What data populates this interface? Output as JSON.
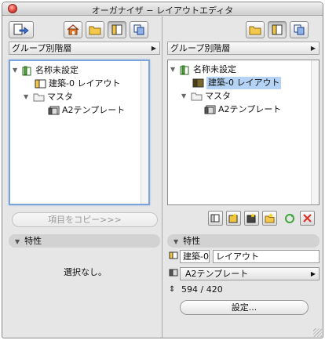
{
  "window": {
    "title": "オーガナイザ − レイアウトエディタ"
  },
  "left": {
    "toolbar": {
      "export_icon": "export-arrow-icon",
      "view_icons": [
        "house-icon",
        "folder-icon",
        "layout-sheet-icon",
        "copy-sheets-icon"
      ],
      "active_index": 2
    },
    "group_selector": "グループ別階層",
    "tree": [
      {
        "label": "名称未設定",
        "icon": "layout-book-icon",
        "expanded": true
      },
      {
        "label": "建築-0 レイアウト",
        "icon": "layout-icon"
      },
      {
        "label": "マスタ",
        "icon": "folder-icon",
        "expanded": true
      },
      {
        "label": "A2テンプレート",
        "icon": "master-layout-icon"
      }
    ],
    "copy_button": "項目をコピー>>>",
    "properties": {
      "header": "特性",
      "empty_text": "選択なし。"
    }
  },
  "right": {
    "toolbar": {
      "view_icons": [
        "folder-icon",
        "layout-sheet-icon",
        "copy-sheets-icon"
      ],
      "active_index": 1
    },
    "group_selector": "グループ別階層",
    "tree": [
      {
        "label": "名称未設定",
        "icon": "layout-book-icon",
        "expanded": true
      },
      {
        "label": "建築-0 レイアウト",
        "icon": "layout-icon",
        "selected": true
      },
      {
        "label": "マスタ",
        "icon": "folder-icon",
        "expanded": true
      },
      {
        "label": "A2テンプレート",
        "icon": "master-layout-icon"
      }
    ],
    "action_icons": [
      "new-layout-icon",
      "new-master-icon",
      "new-subset-icon",
      "new-folder-icon",
      "refresh-icon",
      "delete-icon"
    ],
    "properties": {
      "header": "特性",
      "id_value": "建築-0",
      "name_value": "レイアウト",
      "master_value": "A2テンプレート",
      "size_value": "594 / 420",
      "settings_button": "設定..."
    }
  },
  "colors": {
    "selection": "#b5d3f5",
    "delete": "#d8322a",
    "refresh": "#3fa63a",
    "focus_ring": "#7aa3d9"
  }
}
